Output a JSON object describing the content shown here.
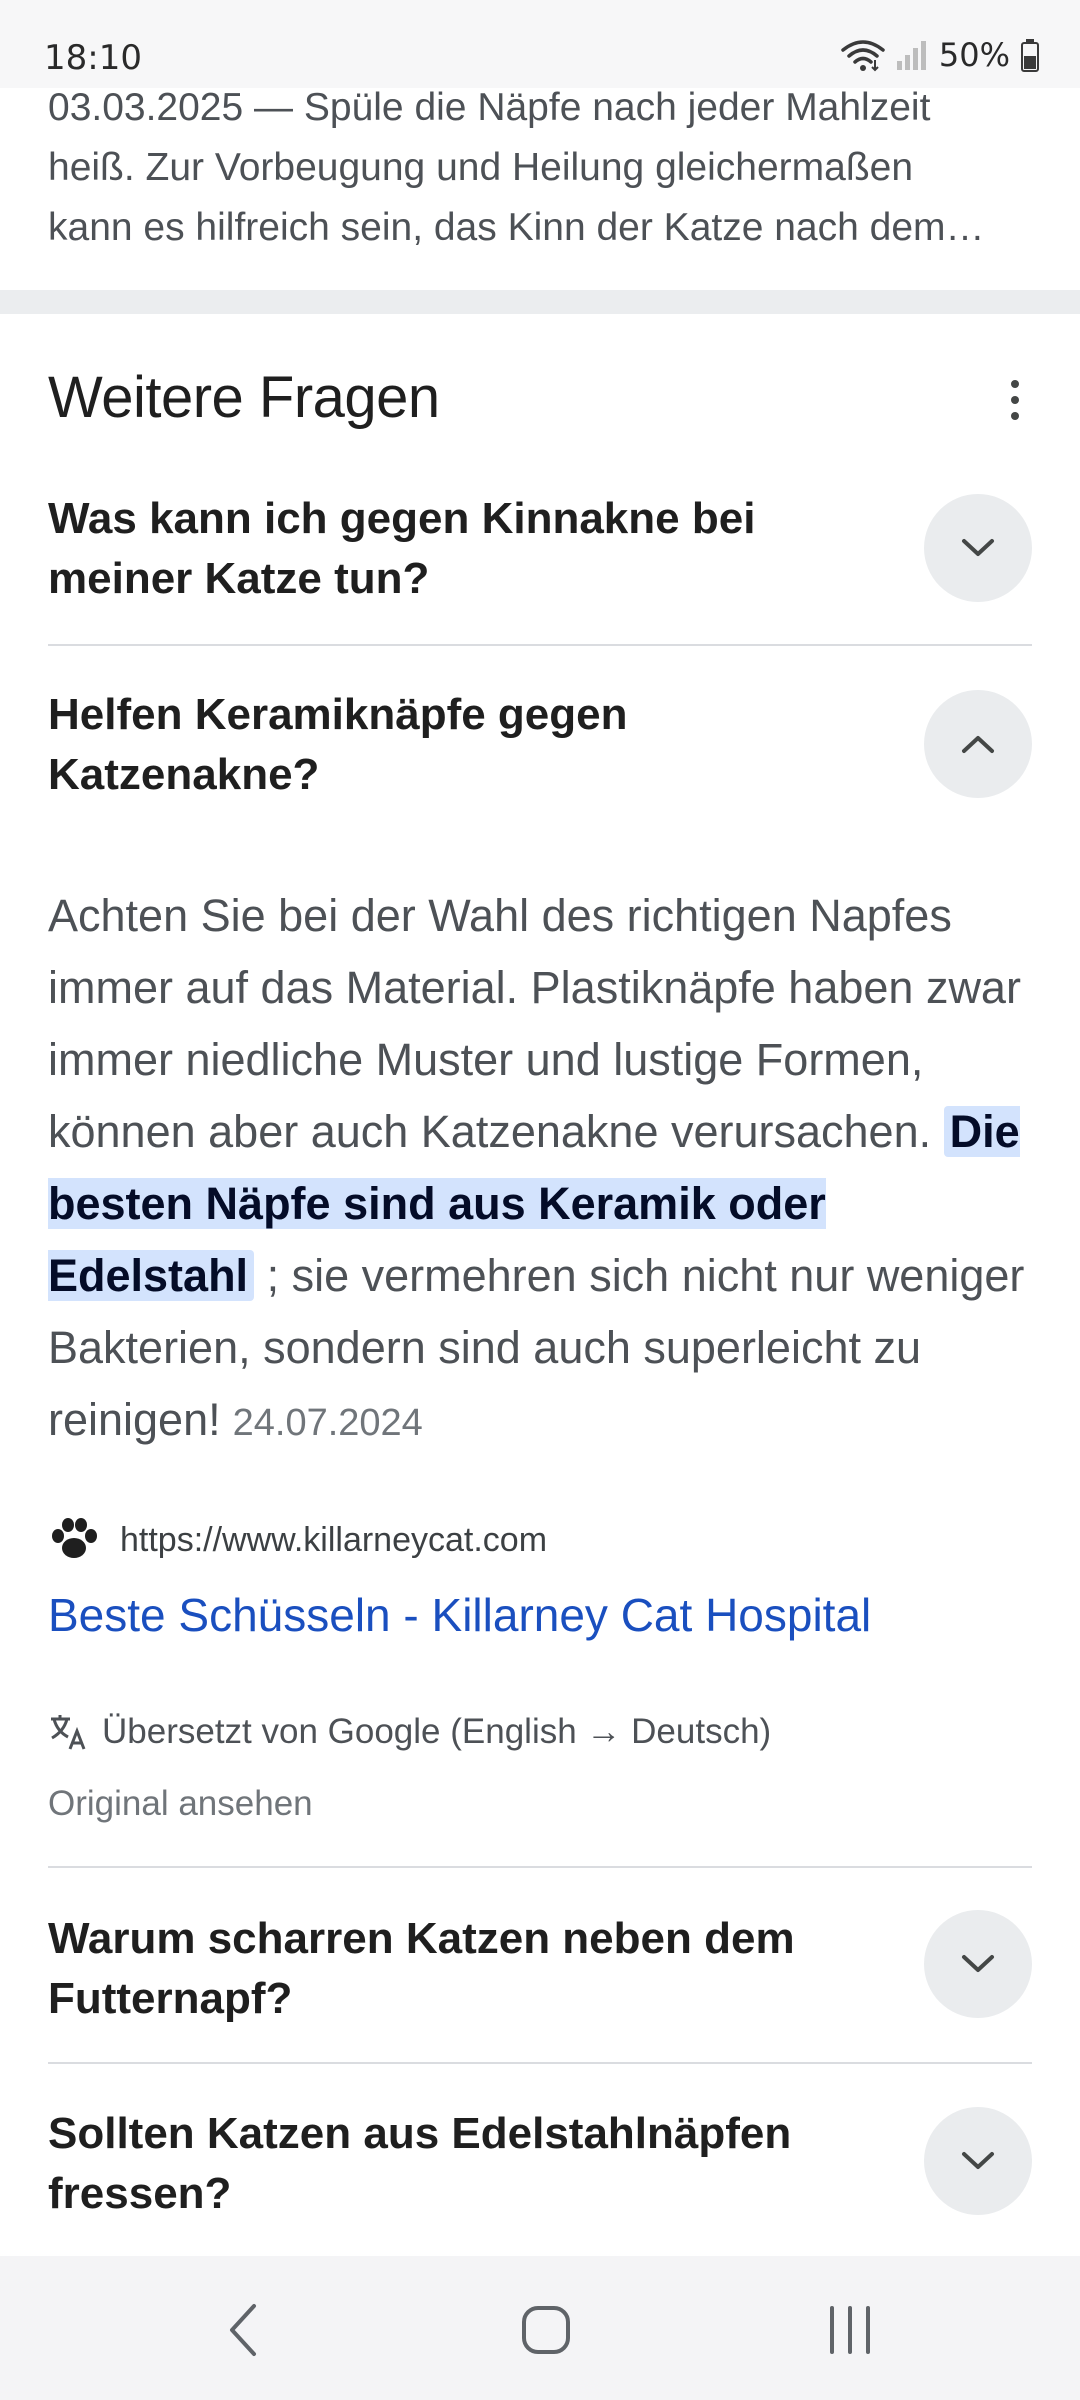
{
  "status_bar": {
    "time": "18:10",
    "battery": "50%"
  },
  "previous_result": {
    "line1": "03.03.2025 — Spüle die Näpfe nach jeder Mahlzeit",
    "line2": "heiß. Zur Vorbeugung und Heilung gleichermaßen",
    "line3": "kann es hilfreich sein, das Kinn der Katze nach dem…"
  },
  "paa": {
    "title": "Weitere Fragen",
    "q1": "Was kann ich gegen Kinnakne bei meiner Katze tun?",
    "q2": "Helfen Keramiknäpfe gegen Katzenakne?",
    "q3": "Warum scharren Katzen neben dem Futternapf?",
    "q4": "Sollten Katzen aus Edelstahlnäpfen fressen?"
  },
  "answer": {
    "text_before": "Achten Sie bei der Wahl des richtigen Napfes immer auf das Material. Plastiknäpfe haben zwar immer niedliche Muster und lustige Formen, können aber auch Katzenakne verursachen. ",
    "highlight": "Die besten Näpfe sind aus Keramik oder Edelstahl",
    "text_after": " ; sie vermehren sich nicht nur weniger Bakterien, sondern sind auch superleicht zu reinigen!",
    "date": "24.07.2024"
  },
  "source": {
    "url": "https://www.killarneycat.com",
    "title": "Beste Schüsseln - Killarney Cat Hospital",
    "translated_note": "Übersetzt von Google (English → Deutsch)",
    "original_link": "Original ansehen"
  },
  "icons": {
    "wifi": "wifi-icon",
    "signal": "signal-icon",
    "battery": "battery-icon",
    "more": "more-vert-icon",
    "expand": "chevron-down-icon",
    "collapse": "chevron-up-icon",
    "favicon": "paw-icon",
    "translate": "translate-icon",
    "back": "back-icon",
    "home": "home-icon",
    "recents": "recents-icon"
  },
  "colors": {
    "link": "#1a4fbf",
    "highlight_bg": "#d3e3fd",
    "chip_bg": "#eaecee"
  }
}
